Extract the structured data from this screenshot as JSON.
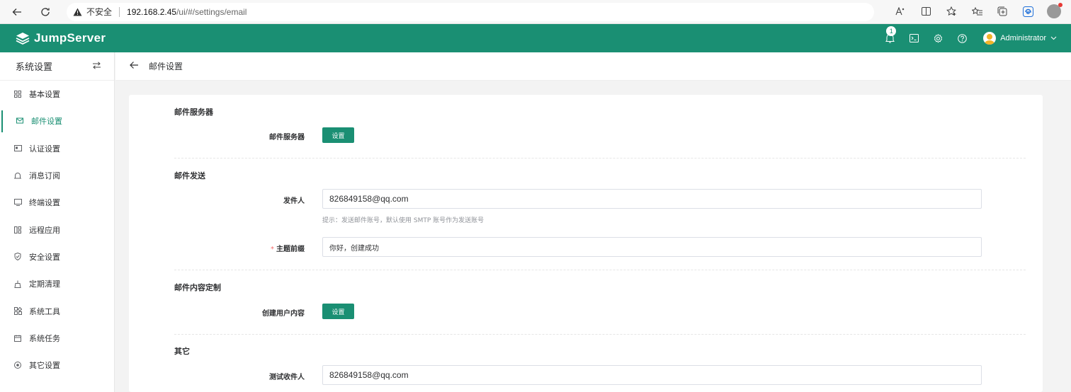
{
  "browser": {
    "insecure_label": "不安全",
    "url_host": "192.168.2.45",
    "url_path": "/ui/#/settings/email"
  },
  "header": {
    "logo_text": "JumpServer",
    "notification_count": "1",
    "user_name": "Administrator"
  },
  "sidebar": {
    "title": "系统设置",
    "items": [
      {
        "label": "基本设置",
        "icon": "grid-icon"
      },
      {
        "label": "邮件设置",
        "icon": "mail-icon",
        "active": true
      },
      {
        "label": "认证设置",
        "icon": "id-card-icon"
      },
      {
        "label": "消息订阅",
        "icon": "bell-icon"
      },
      {
        "label": "终端设置",
        "icon": "monitor-icon"
      },
      {
        "label": "远程应用",
        "icon": "apps-icon"
      },
      {
        "label": "安全设置",
        "icon": "shield-icon"
      },
      {
        "label": "定期清理",
        "icon": "broom-icon"
      },
      {
        "label": "系统工具",
        "icon": "tools-icon"
      },
      {
        "label": "系统任务",
        "icon": "calendar-icon"
      },
      {
        "label": "其它设置",
        "icon": "settings-circle-icon"
      }
    ]
  },
  "page": {
    "title": "邮件设置"
  },
  "form": {
    "sections": {
      "server": "邮件服务器",
      "send": "邮件发送",
      "custom": "邮件内容定制",
      "other": "其它"
    },
    "server_label": "邮件服务器",
    "server_button": "设置",
    "sender_label": "发件人",
    "sender_value": "826849158@qq.com",
    "sender_hint": "提示：发送邮件账号，默认使用 SMTP 账号作为发送账号",
    "subject_required_mark": "*",
    "subject_label": "主题前缀",
    "subject_value": "你好，创建成功",
    "create_user_label": "创建用户内容",
    "create_user_button": "设置",
    "test_recipient_label": "测试收件人",
    "test_recipient_value": "826849158@qq.com"
  },
  "colors": {
    "brand": "#1a8f73"
  }
}
